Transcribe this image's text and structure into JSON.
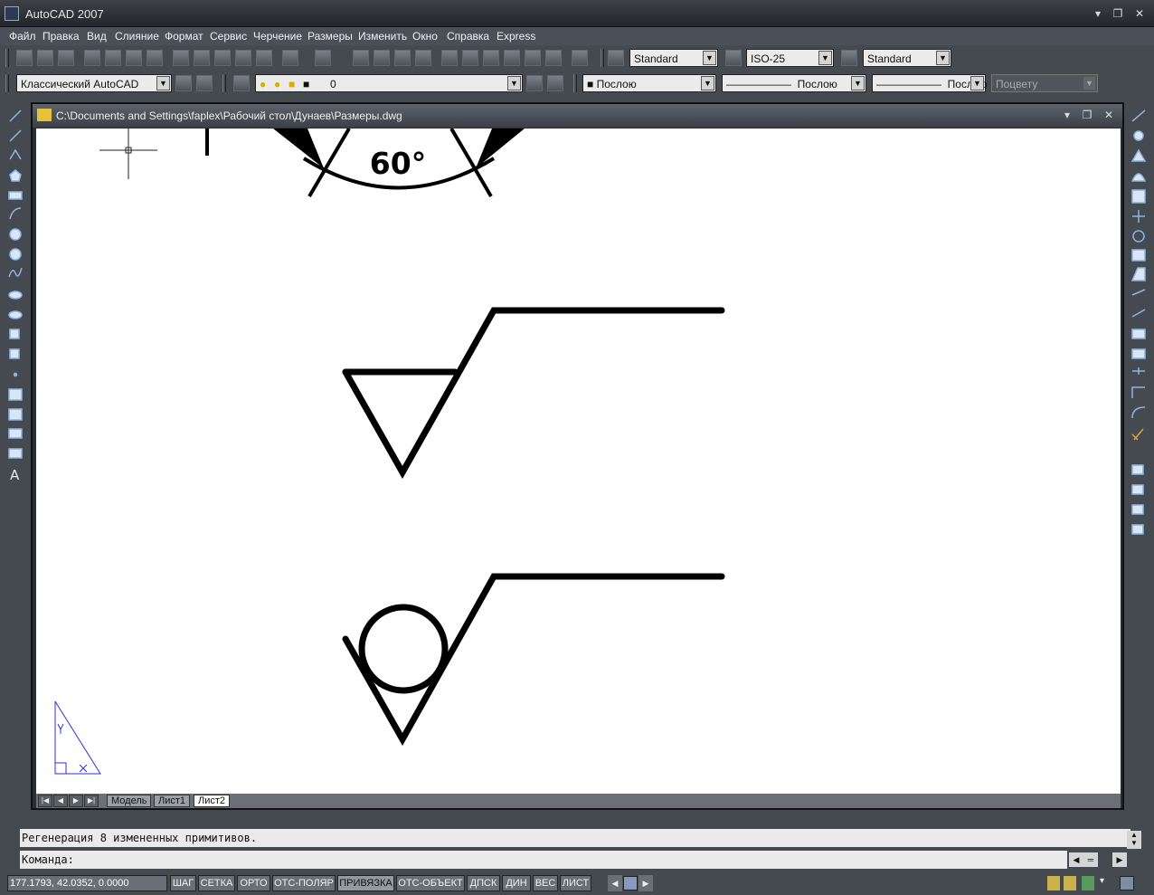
{
  "app": {
    "title": "AutoCAD 2007"
  },
  "menu": [
    "Файл",
    "Правка",
    "Вид",
    "Слияние",
    "Формат",
    "Сервис",
    "Черчение",
    "Размеры",
    "Изменить",
    "Окно",
    "Справка",
    "Express"
  ],
  "toolbar1": {
    "text_style": "Standard",
    "dim_style": "ISO-25",
    "table_style": "Standard"
  },
  "toolbar2": {
    "workspace": "Классический AutoCAD",
    "layer": "0",
    "color": "Послою",
    "linetype": "Послою",
    "lineweight": "Послою",
    "plotstyle": "Поцвету"
  },
  "drawing": {
    "path": "C:\\Documents and Settings\\faplex\\Рабочий стол\\Дунаев\\Размеры.dwg",
    "angle_label": "60°"
  },
  "tabs": [
    "Модель",
    "Лист1",
    "Лист2"
  ],
  "active_tab": "Лист2",
  "command": {
    "history": "Регенерация 8 измененных примитивов.",
    "prompt": "Команда:"
  },
  "status": {
    "coords": "177.1793, 42.0352, 0.0000",
    "buttons": [
      "ШАГ",
      "СЕТКА",
      "ОРТО",
      "ОТС-ПОЛЯР",
      "ПРИВЯЗКА",
      "ОТС-ОБЪЕКТ",
      "ДПСК",
      "ДИН",
      "ВЕС",
      "ЛИСТ"
    ],
    "active_buttons": [
      "ПРИВЯЗКА"
    ]
  }
}
